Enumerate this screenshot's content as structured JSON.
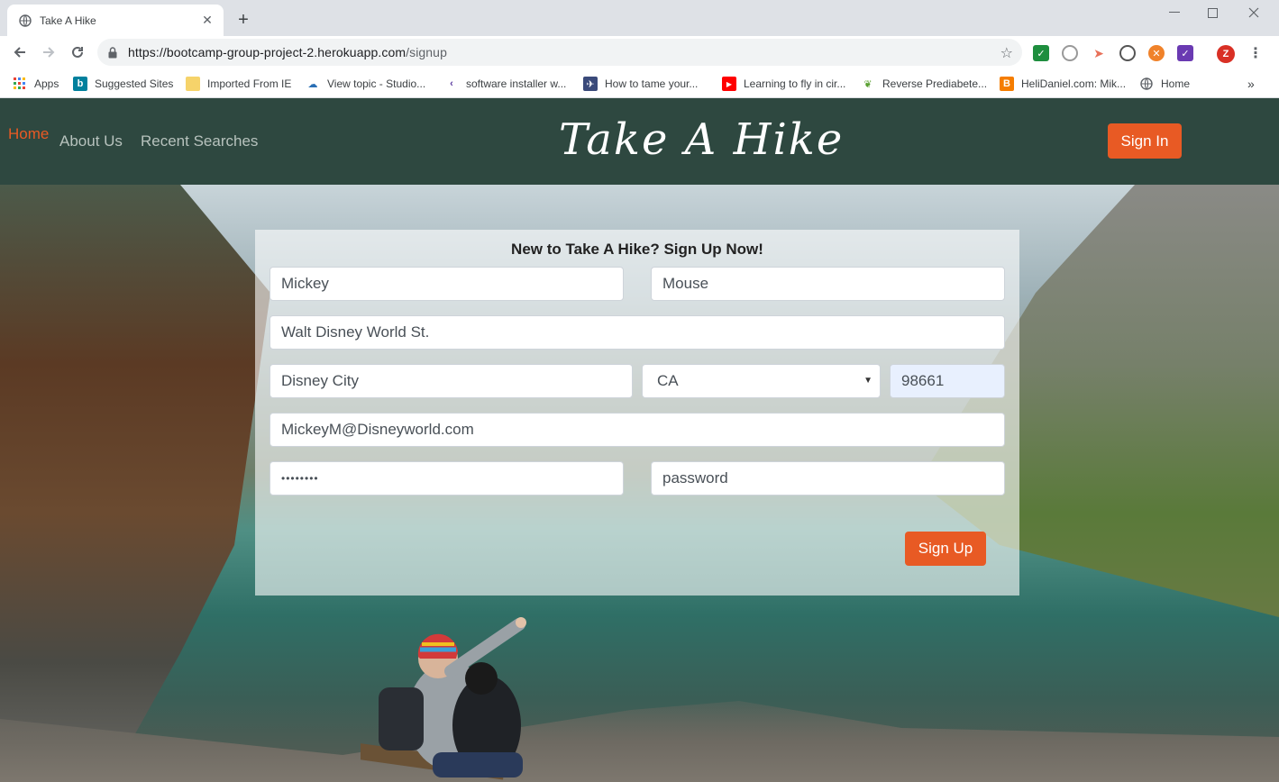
{
  "browser": {
    "tab_title": "Take A Hike",
    "url_host": "https://bootcamp-group-project-2.herokuapp.com",
    "url_path": "/signup",
    "bookmarks": [
      {
        "label": "Apps",
        "icon": "apps-grid-icon"
      },
      {
        "label": "Suggested Sites",
        "icon": "bing-icon"
      },
      {
        "label": "Imported From IE",
        "icon": "folder-icon"
      },
      {
        "label": "View topic - Studio...",
        "icon": "forum-icon"
      },
      {
        "label": "software installer w...",
        "icon": "chevron-left-icon"
      },
      {
        "label": "How to tame your...",
        "icon": "site-icon"
      },
      {
        "label": "Learning to fly in cir...",
        "icon": "youtube-icon"
      },
      {
        "label": "Reverse Prediabete...",
        "icon": "leaf-icon"
      },
      {
        "label": "HeliDaniel.com: Mik...",
        "icon": "blogger-icon"
      },
      {
        "label": "Home",
        "icon": "globe-icon"
      }
    ],
    "profile_initial": "Z"
  },
  "site": {
    "nav": {
      "home": "Home",
      "about": "About Us",
      "recent": "Recent Searches"
    },
    "brand": "Take A Hike",
    "signin_label": "Sign In",
    "colors": {
      "header": "#2e4840",
      "accent": "#e85a24"
    }
  },
  "form": {
    "title": "New to Take A Hike? Sign Up Now!",
    "first_name": "Mickey",
    "last_name": "Mouse",
    "address": "Walt Disney World St.",
    "city": "Disney City",
    "state": "CA",
    "zip": "98661",
    "email": "MickeyM@Disneyworld.com",
    "password_mask": "••••••••",
    "confirm_placeholder": "password",
    "submit_label": "Sign Up"
  }
}
